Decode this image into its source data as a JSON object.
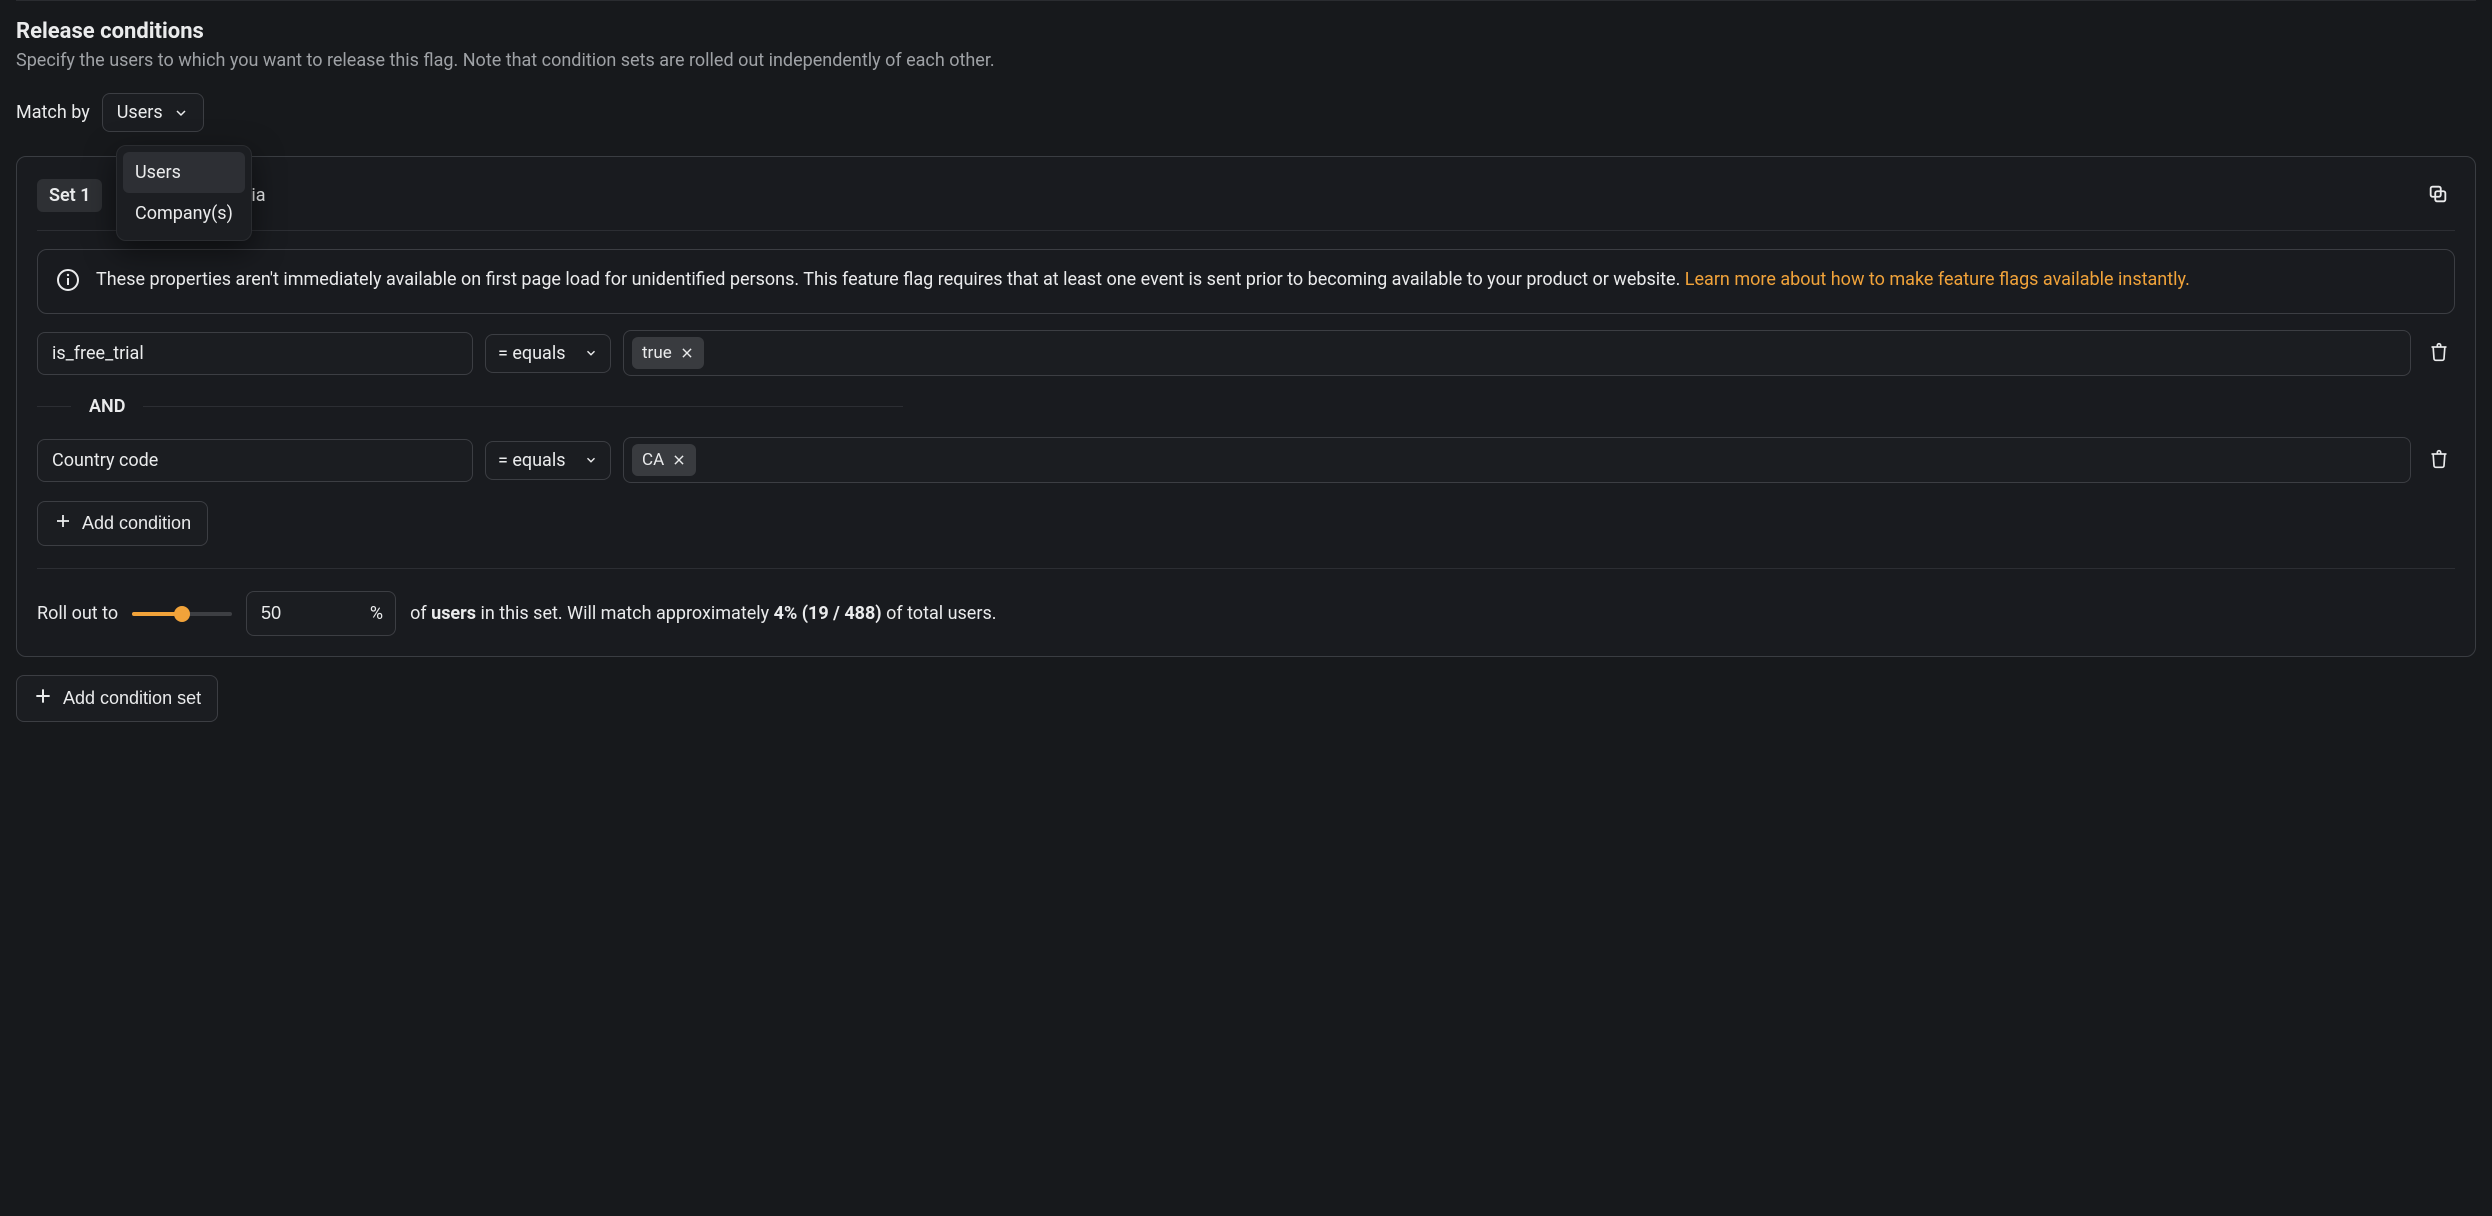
{
  "header": {
    "title": "Release conditions",
    "subtitle": "Specify the users to which you want to release this flag. Note that condition sets are rolled out independently of each other."
  },
  "match_by": {
    "label": "Match by",
    "selected": "Users",
    "options": [
      "Users",
      "Company(s)"
    ]
  },
  "set": {
    "badge": "Set 1",
    "head_suffix": "against the criteria",
    "info": {
      "text": "These properties aren't immediately available on first page load for unidentified persons. This feature flag requires that at least one event is sent prior to becoming available to your product or website. ",
      "link": "Learn more about how to make feature flags available instantly."
    },
    "conditions": [
      {
        "property": "is_free_trial",
        "operator": "= equals",
        "values": [
          "true"
        ]
      },
      {
        "property": "Country code",
        "operator": "= equals",
        "values": [
          "CA"
        ]
      }
    ],
    "and_label": "AND",
    "add_condition": "Add condition",
    "rollout": {
      "label": "Roll out to",
      "value": "50",
      "percent_sign": "%",
      "text_prefix": "of ",
      "users_word": "users",
      "text_mid": " in this set.  Will match approximately ",
      "approx_pct": "4%",
      "counts": " (19 / 488) ",
      "text_suffix": "of total users."
    }
  },
  "add_set": "Add condition set"
}
